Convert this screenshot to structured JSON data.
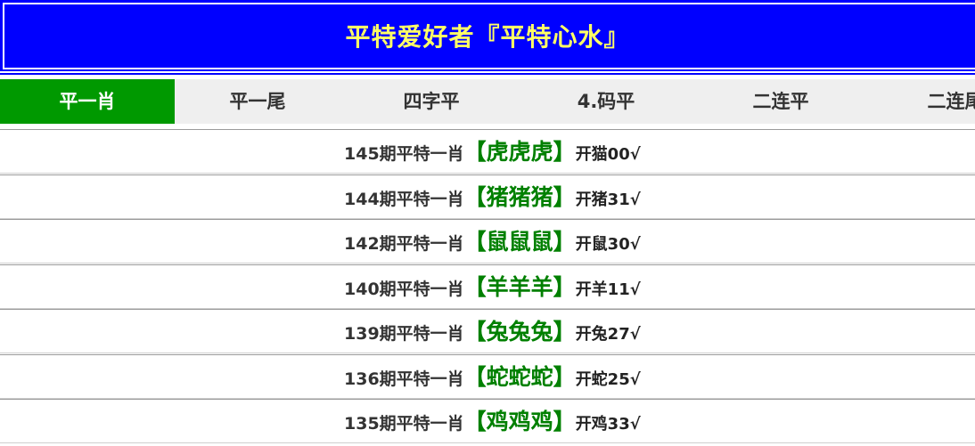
{
  "header": {
    "title": "平特爱好者『平特心水』"
  },
  "tabs": [
    {
      "label": "平一肖",
      "active": true
    },
    {
      "label": "平一尾",
      "active": false
    },
    {
      "label": "四字平",
      "active": false
    },
    {
      "label": "4.码平",
      "active": false
    },
    {
      "label": "二连平",
      "active": false
    },
    {
      "label": "二连尾",
      "active": false
    }
  ],
  "rows": [
    {
      "issue": "145期平特一肖",
      "pick": "【虎虎虎】",
      "result": "开猫00",
      "mark": "√"
    },
    {
      "issue": "144期平特一肖",
      "pick": "【猪猪猪】",
      "result": "开猪31",
      "mark": "√"
    },
    {
      "issue": "142期平特一肖",
      "pick": "【鼠鼠鼠】",
      "result": "开鼠30",
      "mark": "√"
    },
    {
      "issue": "140期平特一肖",
      "pick": "【羊羊羊】",
      "result": "开羊11",
      "mark": "√"
    },
    {
      "issue": "139期平特一肖",
      "pick": "【兔兔兔】",
      "result": "开兔27",
      "mark": "√"
    },
    {
      "issue": "136期平特一肖",
      "pick": "【蛇蛇蛇】",
      "result": "开蛇25",
      "mark": "√"
    },
    {
      "issue": "135期平特一肖",
      "pick": "【鸡鸡鸡】",
      "result": "开鸡33",
      "mark": "√"
    }
  ],
  "colors": {
    "banner_bg": "#0000ff",
    "banner_title": "#ffff66",
    "tab_active_bg": "#009900",
    "tab_bg": "#efefef",
    "pick_text": "#008000"
  }
}
